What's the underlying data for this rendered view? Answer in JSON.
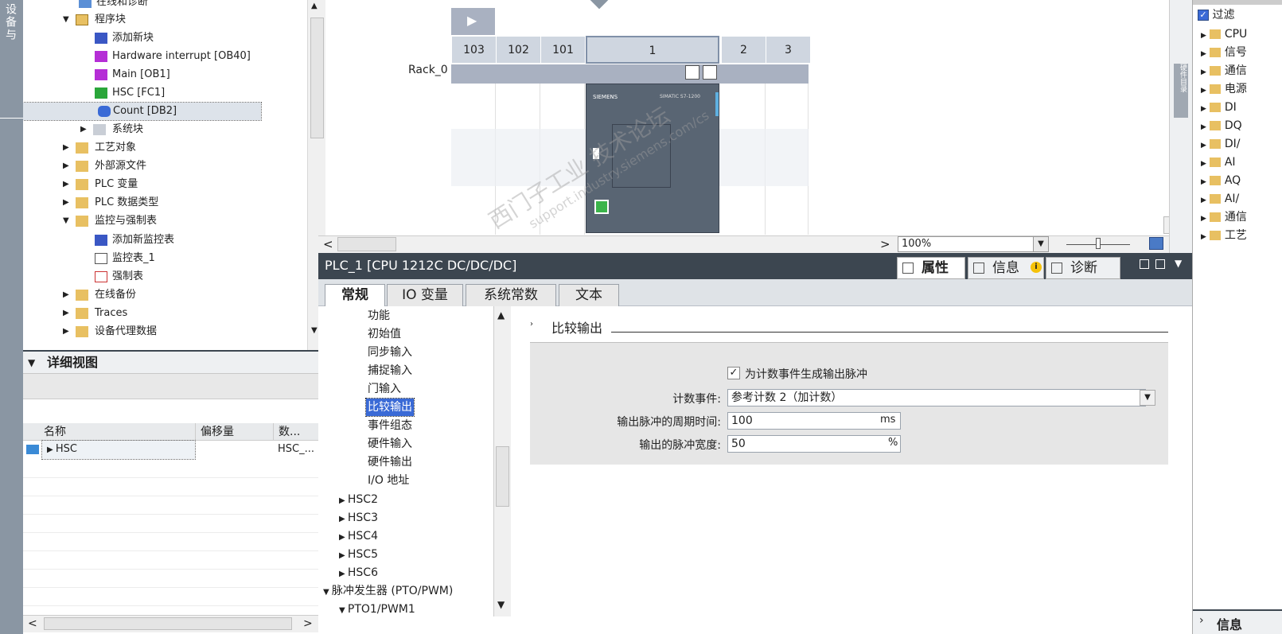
{
  "left_tab": {
    "label": "设备与"
  },
  "tree": {
    "items": [
      {
        "label": "在线和诊断"
      },
      {
        "label": "程序块"
      },
      {
        "label": "添加新块"
      },
      {
        "label": "Hardware interrupt [OB40]"
      },
      {
        "label": "Main [OB1]"
      },
      {
        "label": "HSC [FC1]"
      },
      {
        "label": "Count [DB2]"
      },
      {
        "label": "系统块"
      },
      {
        "label": "工艺对象"
      },
      {
        "label": "外部源文件"
      },
      {
        "label": "PLC 变量"
      },
      {
        "label": "PLC 数据类型"
      },
      {
        "label": "监控与强制表"
      },
      {
        "label": "添加新监控表"
      },
      {
        "label": "监控表_1"
      },
      {
        "label": "强制表"
      },
      {
        "label": "在线备份"
      },
      {
        "label": "Traces"
      },
      {
        "label": "设备代理数据"
      }
    ]
  },
  "detail": {
    "title": "详细视图",
    "columns": [
      "名称",
      "偏移量",
      "数..."
    ],
    "row": {
      "name": "HSC",
      "type": "HSC_..."
    }
  },
  "device": {
    "rack_label": "Rack_0",
    "slots": [
      "103",
      "102",
      "101",
      "1",
      "2",
      "3"
    ],
    "zoom": "100%",
    "cpu_brand": "SIEMENS",
    "cpu_model": "SIMATIC S7-1200"
  },
  "inspector": {
    "title": "PLC_1 [CPU 1212C DC/DC/DC]",
    "tabs": [
      "属性",
      "信息",
      "诊断"
    ],
    "prop_tabs": [
      "常规",
      "IO 变量",
      "系统常数",
      "文本"
    ]
  },
  "nav": {
    "items": [
      "功能",
      "初始值",
      "同步输入",
      "捕捉输入",
      "门输入",
      "比较输出",
      "事件组态",
      "硬件输入",
      "硬件输出",
      "I/O 地址",
      "HSC2",
      "HSC3",
      "HSC4",
      "HSC5",
      "HSC6",
      "脉冲发生器 (PTO/PWM)",
      "PTO1/PWM1"
    ]
  },
  "section": {
    "title": "比较输出",
    "checkbox_label": "为计数事件生成输出脉冲",
    "count_event_label": "计数事件:",
    "count_event_value": "参考计数 2（加计数）",
    "period_label": "输出脉冲的周期时间:",
    "period_value": "100",
    "period_unit": "ms",
    "width_label": "输出的脉冲宽度:",
    "width_value": "50",
    "width_unit": "%"
  },
  "watermark": {
    "line1": "西门子工业 技术论坛",
    "line2": "support.industry.siemens.com/cs"
  },
  "right_panel": {
    "filter_label": "过滤",
    "items": [
      "CPU",
      "信号",
      "通信",
      "电源",
      "DI",
      "DQ",
      "DI/",
      "AI",
      "AQ",
      "AI/",
      "通信",
      "工艺"
    ],
    "bottom_label": "信息"
  },
  "vtab": {
    "label": "硬件目录"
  }
}
